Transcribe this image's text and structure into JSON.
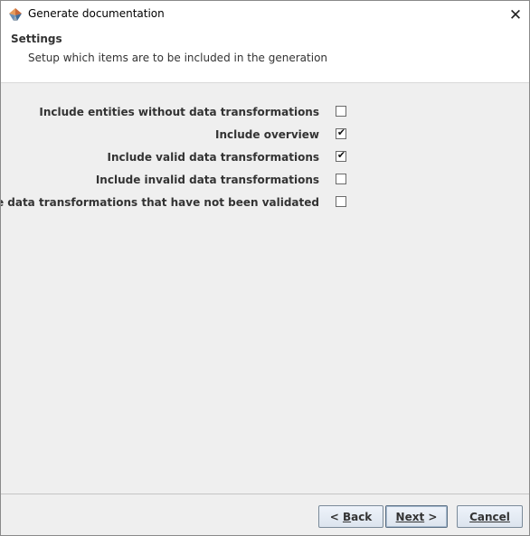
{
  "window": {
    "title": "Generate documentation",
    "close_glyph": "✕"
  },
  "header": {
    "title": "Settings",
    "subtitle": "Setup which items are to be included in the generation"
  },
  "options": [
    {
      "label": "Include entities without data transformations",
      "checked": false
    },
    {
      "label": "Include overview",
      "checked": true
    },
    {
      "label": "Include valid data transformations",
      "checked": true
    },
    {
      "label": "Include invalid data transformations",
      "checked": false
    },
    {
      "label": "Include data transformations that have not been validated",
      "checked": false
    }
  ],
  "buttons": {
    "back": {
      "mnemonic": "B",
      "rest": "ack",
      "prefix": "< "
    },
    "next": {
      "mnemonic": "N",
      "rest": "ext",
      "suffix": " >"
    },
    "cancel": {
      "mnemonic": "C",
      "rest": "ancel"
    }
  },
  "colors": {
    "header_bg": "#ffffff",
    "panel_bg": "#efefef",
    "text": "#333333"
  },
  "icons": {
    "app": "app-logo-icon",
    "close": "close-icon",
    "check": "checkmark-icon"
  }
}
